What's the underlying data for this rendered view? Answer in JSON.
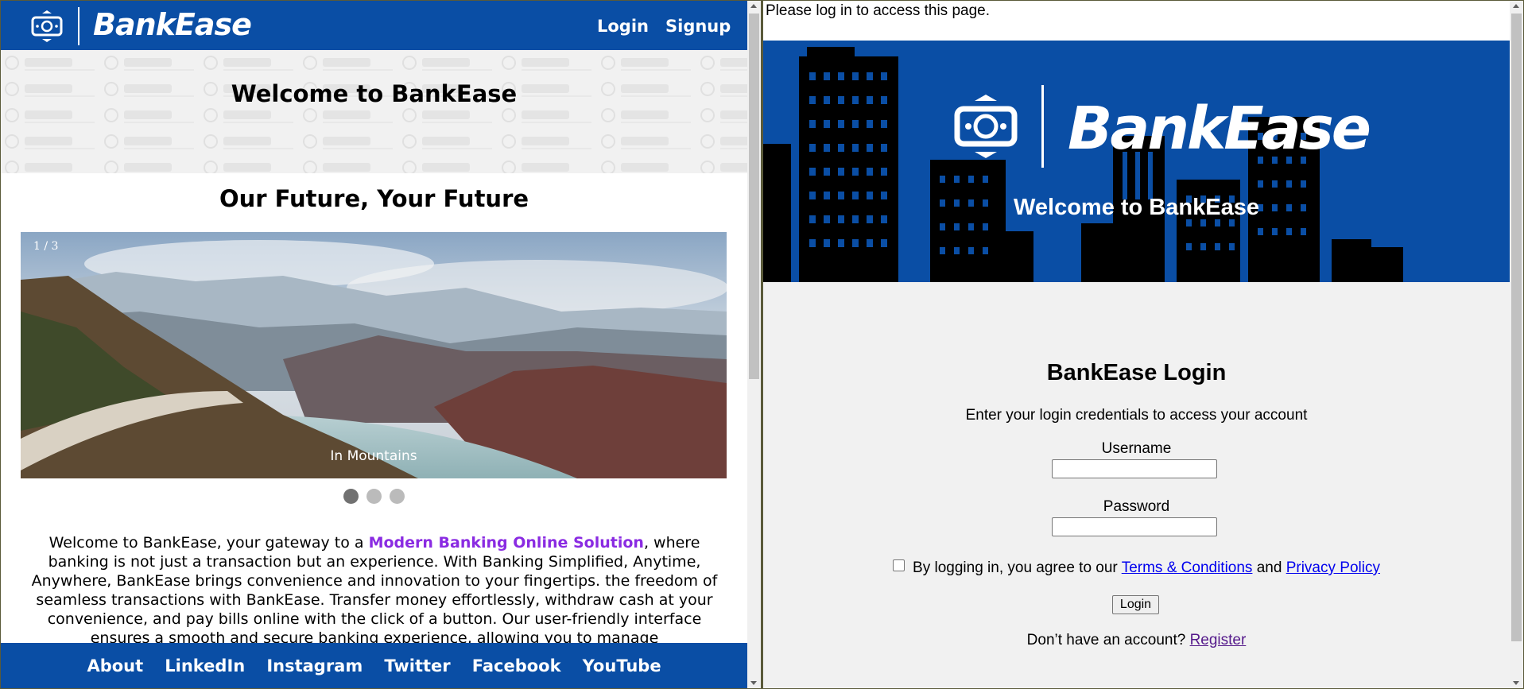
{
  "left": {
    "brand": "BankEase",
    "nav": {
      "login": "Login",
      "signup": "Signup"
    },
    "hero_title": "Welcome to BankEase",
    "section_title": "Our Future, Your Future",
    "slideshow": {
      "counter": "1 / 3",
      "caption": "In Mountains",
      "slides": 3,
      "active_index": 1
    },
    "paragraph": {
      "before": "Welcome to BankEase, your gateway to a ",
      "accent": "Modern Banking Online Solution",
      "after": ", where banking is not just a transaction but an experience. With Banking Simplified, Anytime, Anywhere, BankEase brings convenience and innovation to your fingertips. the freedom of seamless transactions with BankEase. Transfer money effortlessly, withdraw cash at your convenience, and pay bills online with the click of a button. Our user-friendly interface ensures a smooth and secure banking experience, allowing you to manage"
    },
    "footer": [
      "About",
      "LinkedIn",
      "Instagram",
      "Twitter",
      "Facebook",
      "YouTube"
    ]
  },
  "right": {
    "notice": "Please log in to access this page.",
    "banner_brand": "BankEase",
    "banner_sub": "Welcome to BankEase",
    "login_title": "BankEase Login",
    "login_sub": "Enter your login credentials to access your account",
    "username_label": "Username",
    "password_label": "Password",
    "terms_prefix": "By logging in, you agree to our ",
    "terms_link": "Terms & Conditions",
    "terms_and": " and ",
    "privacy_link": "Privacy Policy",
    "login_button": "Login",
    "register_prefix": "Don’t have an account? ",
    "register_link": "Register"
  },
  "colors": {
    "brand_blue": "#0a4ea5",
    "accent_purple": "#8a2be2",
    "link": "#0000ee",
    "visited_link": "#551a8b"
  }
}
